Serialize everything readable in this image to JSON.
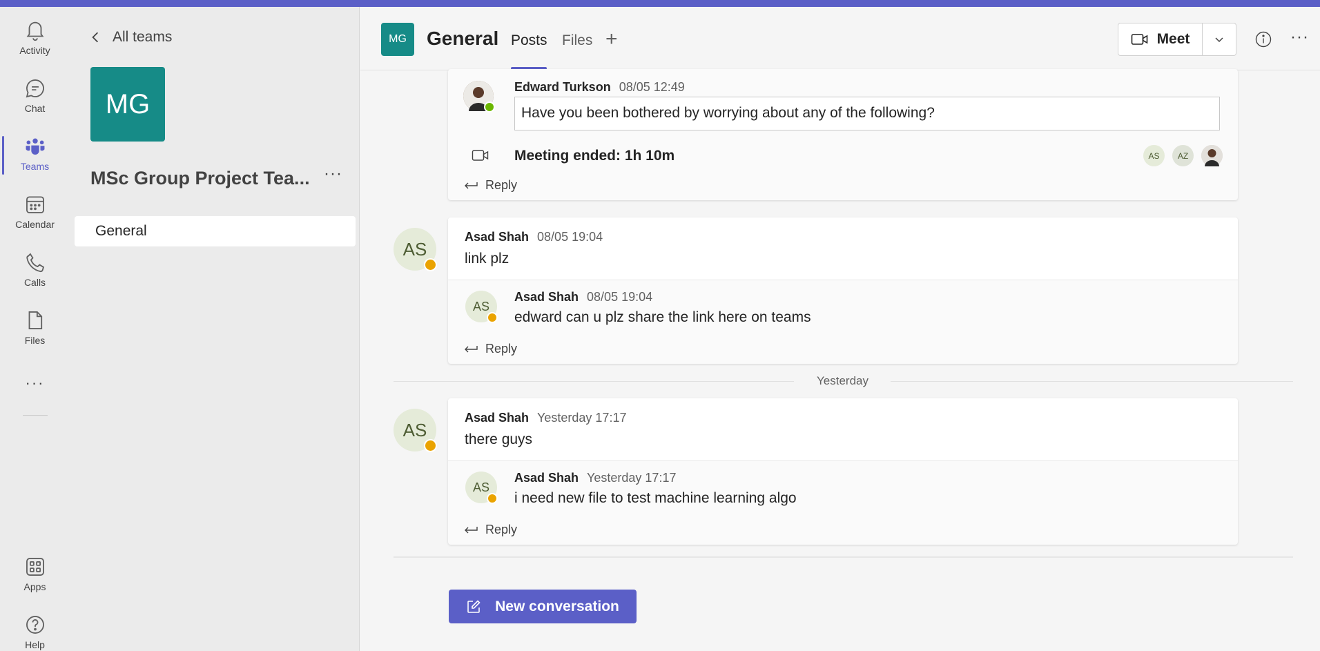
{
  "rail": {
    "items": [
      {
        "label": "Activity",
        "icon": "bell-icon"
      },
      {
        "label": "Chat",
        "icon": "chat-icon"
      },
      {
        "label": "Teams",
        "icon": "teams-icon"
      },
      {
        "label": "Calendar",
        "icon": "calendar-icon"
      },
      {
        "label": "Calls",
        "icon": "phone-icon"
      },
      {
        "label": "Files",
        "icon": "file-icon"
      },
      {
        "label": "Apps",
        "icon": "apps-icon"
      },
      {
        "label": "Help",
        "icon": "help-icon"
      }
    ],
    "more": "···",
    "active": "Teams"
  },
  "team": {
    "back_label": "All teams",
    "avatar_initials": "MG",
    "name": "MSc Group Project Tea...",
    "more": "···",
    "channels": [
      "General"
    ]
  },
  "header": {
    "avatar_initials": "MG",
    "channel_title": "General",
    "tabs": [
      "Posts",
      "Files"
    ],
    "add_tab": "+",
    "meet_label": "Meet",
    "more": "···"
  },
  "thread1": {
    "reply": {
      "author": "Edward Turkson",
      "time": "08/05 12:49",
      "text": "Have you been bothered by worrying about any of the following?"
    },
    "meeting": {
      "text": "Meeting ended: 1h 10m",
      "participants": [
        "AS",
        "AZ"
      ]
    },
    "reply_label": "Reply"
  },
  "thread2": {
    "root": {
      "initials": "AS",
      "author": "Asad Shah",
      "time": "08/05 19:04",
      "text": "link plz"
    },
    "reply": {
      "initials": "AS",
      "author": "Asad Shah",
      "time": "08/05 19:04",
      "text": "edward can u plz share the link here on teams"
    },
    "reply_label": "Reply"
  },
  "divider": "Yesterday",
  "thread3": {
    "root": {
      "initials": "AS",
      "author": "Asad Shah",
      "time": "Yesterday 17:17",
      "text": "there guys"
    },
    "reply": {
      "initials": "AS",
      "author": "Asad Shah",
      "time": "Yesterday 17:17",
      "text": "i need new file to test machine learning algo"
    },
    "reply_label": "Reply"
  },
  "new_conversation": "New conversation",
  "colors": {
    "accent": "#5b5fc7",
    "team": "#168b87",
    "away": "#eaa300",
    "available": "#6bb700"
  }
}
